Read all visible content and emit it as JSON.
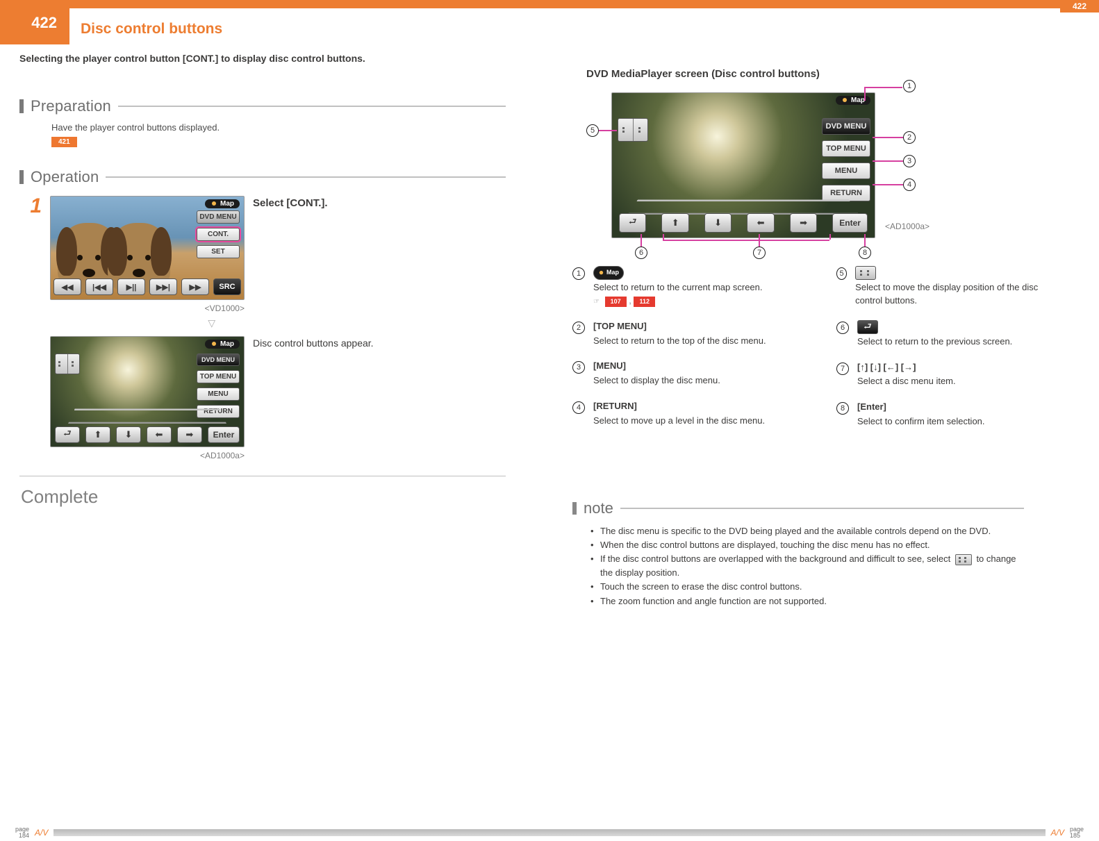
{
  "header": {
    "page_num_top_tab": "422",
    "page_num_box": "422",
    "title": "Disc control buttons",
    "intro": "Selecting the player control button [CONT.] to display disc control buttons."
  },
  "preparation": {
    "title": "Preparation",
    "line": "Have the player control buttons displayed.",
    "ref_badge": "421"
  },
  "operation": {
    "title": "Operation",
    "step_num": "1",
    "step_line": "Select [CONT.].",
    "result_line": "Disc control buttons appear.",
    "screenshot1_ref": "<VD1000>",
    "screenshot2_ref": "<AD1000a>",
    "map_label": "Map",
    "dvd_menu_label": "DVD MENU",
    "cont_label": "CONT.",
    "set_label": "SET",
    "src_label": "SRC",
    "top_menu_label": "TOP MENU",
    "menu_label": "MENU",
    "return_label": "RETURN",
    "enter_label": "Enter"
  },
  "complete_label": "Complete",
  "right": {
    "subtitle": "DVD MediaPlayer screen (Disc control buttons)",
    "diagram_ref": "<AD1000a>"
  },
  "legend": {
    "1": {
      "desc": "Select to return to the current map screen.",
      "refs": [
        "107",
        "112"
      ]
    },
    "2": {
      "head": "[TOP MENU]",
      "desc": "Select to return to the top of the disc menu."
    },
    "3": {
      "head": "[MENU]",
      "desc": "Select to display the disc menu."
    },
    "4": {
      "head": "[RETURN]",
      "desc": "Select to move up a level in the disc menu."
    },
    "5": {
      "desc": "Select to move the display position of the disc control buttons."
    },
    "6": {
      "desc": "Select to return to the previous screen."
    },
    "7": {
      "head": "[↑] [↓] [←] [→]",
      "desc": "Select a disc menu item."
    },
    "8": {
      "head": "[Enter]",
      "desc": "Select to confirm item selection."
    }
  },
  "note": {
    "title": "note",
    "items": [
      "The disc menu is specific to the DVD being played and the available controls depend on the DVD.",
      "When the disc control buttons are displayed, touching the disc menu has no effect.",
      "If the disc control buttons are overlapped with the background and difficult to see, select __ICON__ to change the display position.",
      "Touch the screen to erase the disc control buttons.",
      "The zoom function and angle function are not supported."
    ]
  },
  "footer": {
    "left_page_label": "page",
    "left_page_num": "184",
    "right_page_label": "page",
    "right_page_num": "185",
    "av": "A/V"
  }
}
